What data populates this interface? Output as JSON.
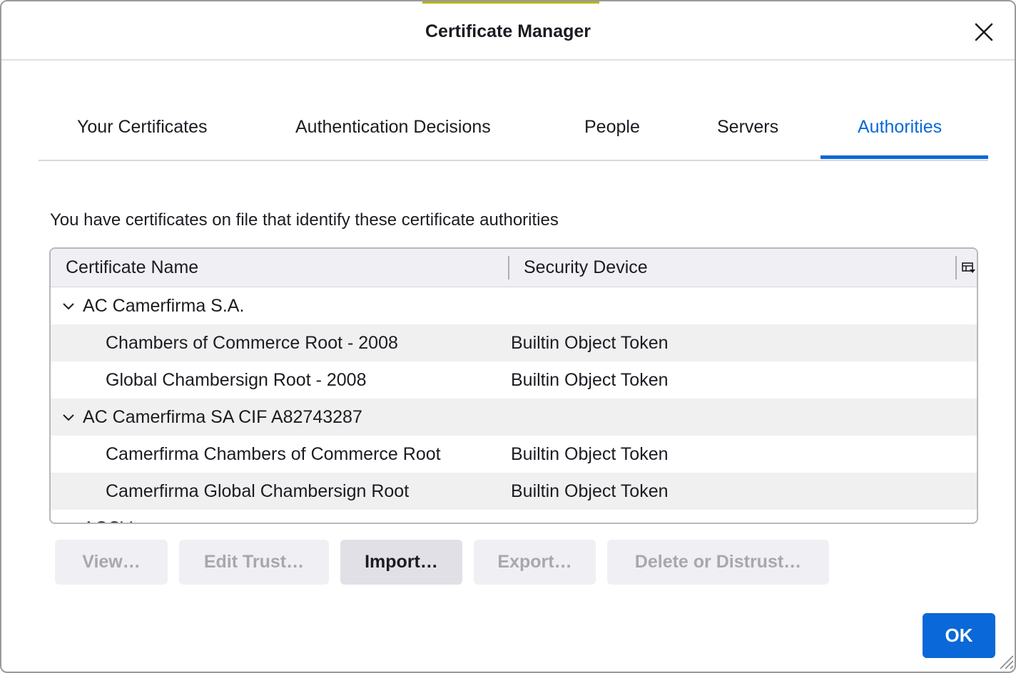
{
  "dialog": {
    "title": "Certificate Manager",
    "close_icon": "close-icon"
  },
  "tabs": [
    {
      "label": "Your Certificates",
      "selected": false
    },
    {
      "label": "Authentication Decisions",
      "selected": false
    },
    {
      "label": "People",
      "selected": false
    },
    {
      "label": "Servers",
      "selected": false
    },
    {
      "label": "Authorities",
      "selected": true
    }
  ],
  "description": "You have certificates on file that identify these certificate authorities",
  "tree": {
    "columns": {
      "name": "Certificate Name",
      "device": "Security Device"
    },
    "column_picker_icon": "column-picker-icon",
    "rows": [
      {
        "type": "group",
        "name": "AC Camerfirma S.A.",
        "expanded": true
      },
      {
        "type": "cert",
        "name": "Chambers of Commerce Root - 2008",
        "device": "Builtin Object Token"
      },
      {
        "type": "cert",
        "name": "Global Chambersign Root - 2008",
        "device": "Builtin Object Token"
      },
      {
        "type": "group",
        "name": "AC Camerfirma SA CIF A82743287",
        "expanded": true
      },
      {
        "type": "cert",
        "name": "Camerfirma Chambers of Commerce Root",
        "device": "Builtin Object Token"
      },
      {
        "type": "cert",
        "name": "Camerfirma Global Chambersign Root",
        "device": "Builtin Object Token"
      },
      {
        "type": "group",
        "name": "ACCV",
        "expanded": true
      }
    ]
  },
  "buttons": {
    "view": "View…",
    "edit_trust": "Edit Trust…",
    "import": "Import…",
    "export": "Export…",
    "delete": "Delete or Distrust…",
    "ok": "OK"
  },
  "colors": {
    "accent": "#0a68d8",
    "disabled_text": "#a7a7ad",
    "row_alt": "#f0f0f0"
  }
}
